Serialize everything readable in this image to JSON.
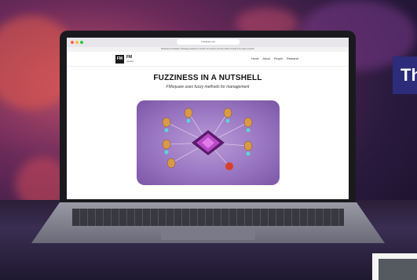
{
  "browser": {
    "url": "fmsquare.org",
    "banner_text": "FMsquare Foundation | Bringing academic methods to business and the public through fuzzy-logic research"
  },
  "site": {
    "logo_mark": "FM",
    "logo_title": "FM",
    "logo_subtitle": "square",
    "nav": [
      "Home",
      "About",
      "People",
      "Research"
    ]
  },
  "hero": {
    "title": "FUZZINESS IN A NUTSHELL",
    "subtitle": "FMsquare uses fuzzy methods for management"
  },
  "side_card": {
    "text": "Th"
  },
  "colors": {
    "accent": "#2c2c7a",
    "art_purple": "#9a76c2",
    "chip": "#7a2a8a"
  }
}
